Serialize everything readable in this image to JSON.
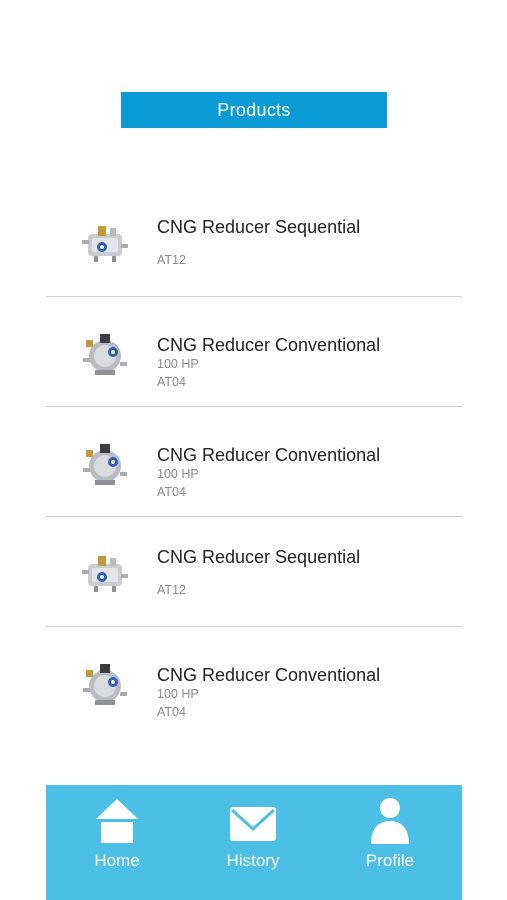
{
  "header": {
    "title": "Products"
  },
  "products": [
    {
      "type": "sequential",
      "name": "CNG Reducer Sequential",
      "code": "AT12"
    },
    {
      "type": "conventional",
      "name": "CNG Reducer Conventional",
      "power": "100 HP",
      "code": "AT04"
    },
    {
      "type": "conventional",
      "name": "CNG Reducer Conventional",
      "power": "100 HP",
      "code": "AT04"
    },
    {
      "type": "sequential",
      "name": "CNG Reducer Sequential",
      "code": "AT12"
    },
    {
      "type": "conventional",
      "name": "CNG Reducer Conventional",
      "power": "100 HP",
      "code": "AT04"
    }
  ],
  "nav": {
    "home": {
      "label": "Home",
      "icon": "home-icon"
    },
    "history": {
      "label": "History",
      "icon": "envelope-icon"
    },
    "profile": {
      "label": "Profile",
      "icon": "person-icon"
    }
  },
  "colors": {
    "header": "#0a9bd6",
    "nav": "#4bbfe6",
    "divider": "#cfcfcf"
  }
}
